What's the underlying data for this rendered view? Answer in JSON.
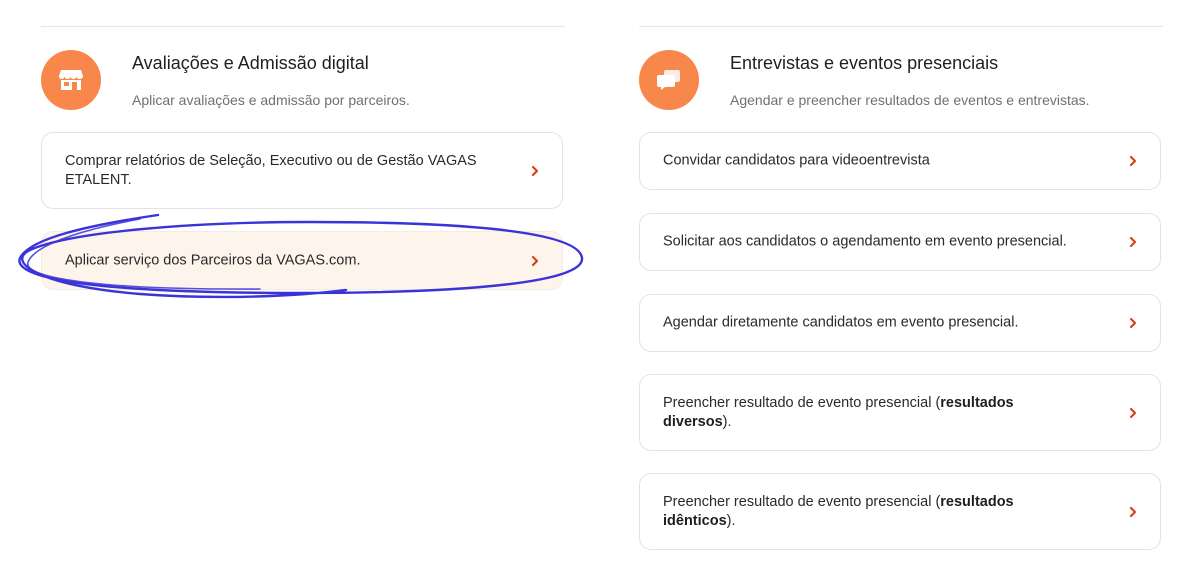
{
  "left_section": {
    "icon": "storefront-icon",
    "title": "Avaliações e Admissão digital",
    "subtitle": "Aplicar avaliações e admissão por parceiros.",
    "items": [
      {
        "label": "Comprar relatórios de Seleção, Executivo ou de Gestão VAGAS ETALENT."
      },
      {
        "label": "Aplicar serviço dos Parceiros da VAGAS.com."
      }
    ]
  },
  "right_section": {
    "icon": "chat-bubbles-icon",
    "title": "Entrevistas e eventos presenciais",
    "subtitle": "Agendar e preencher resultados de eventos e entrevistas.",
    "items": [
      {
        "label": "Convidar candidatos para videoentrevista"
      },
      {
        "label": "Solicitar aos candidatos o agendamento em evento presencial."
      },
      {
        "label": "Agendar diretamente candidatos em evento presencial."
      },
      {
        "label_pre": "Preencher resultado de evento presencial (",
        "label_bold": "resultados diversos",
        "label_post": ")."
      },
      {
        "label_pre": "Preencher resultado de evento presencial (",
        "label_bold": "resultados idênticos",
        "label_post": ")."
      }
    ]
  },
  "colors": {
    "accent_orange": "#f7874a",
    "chevron_red": "#d9411e",
    "highlight_bg": "#fdf4ec",
    "annotation_stroke": "#3a34d8"
  }
}
